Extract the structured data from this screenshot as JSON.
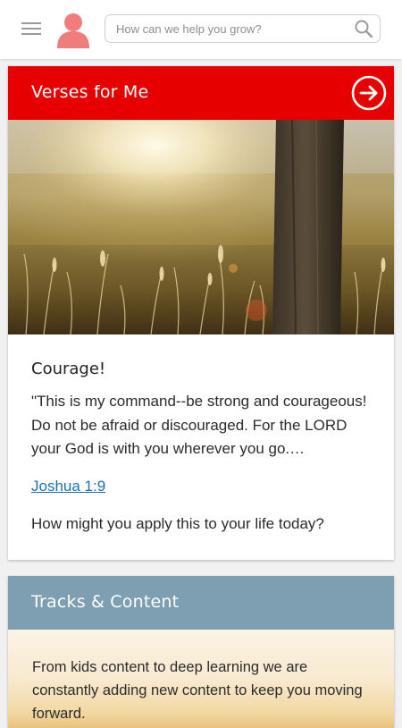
{
  "search": {
    "placeholder": "How can we help you grow?"
  },
  "icons": {
    "menu": "menu-icon",
    "avatar": "user-avatar-icon",
    "search": "search-icon",
    "arrow": "arrow-right-circle-icon"
  },
  "colors": {
    "verses_header": "#e60000",
    "tracks_header": "#7e9fb2",
    "link": "#1a6fb5",
    "avatar": "#f07c7c"
  },
  "verses_card": {
    "header_title": "Verses for Me",
    "verse_title": "Courage!",
    "verse_text": "\"This is my command--be strong and courageous! Do not be afraid or discouraged. For the LORD your God is with you wherever you go.…",
    "reference": "Joshua 1:9",
    "question": "How might you apply this to your life today?"
  },
  "tracks_card": {
    "header_title": "Tracks & Content",
    "description": "From kids content to deep learning we are constantly adding new content to keep you moving forward."
  }
}
